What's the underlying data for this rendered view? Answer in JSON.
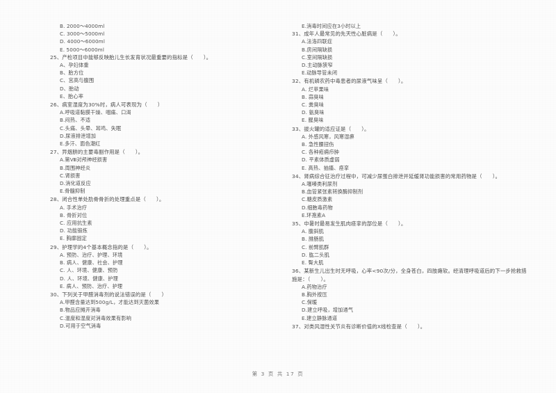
{
  "document": {
    "footer": "第 3 页 共 17 页",
    "page_number": "3",
    "total_pages": "17",
    "ink_color": "#4d4d4d",
    "paper_color": "#fcfcfc"
  },
  "left_column": {
    "orphan_options": [
      "B. 2000～4000ml",
      "C. 3000～5000ml",
      "D. 4000～6000ml",
      "E. 5000～6000ml"
    ],
    "questions": [
      {
        "number": "25",
        "stem": "25、产检项目中能够反映胎儿生长发育状况最重要的指标是（　　）。",
        "options": [
          "A、孕妇体重",
          "B、胎方位",
          "C、宫高与腹围",
          "D、胎动",
          "E、胎心率"
        ]
      },
      {
        "number": "26",
        "stem": "26、病室湿度为30%时，病人可表现为（　　）",
        "options": [
          "A.呼吸道黏膜干燥、咽痛、口渴",
          "B.闷热、不适",
          "C.头痛、头晕、耳鸣、失眠",
          "D.尿液排泄增加",
          "E.多汗、面色潮红"
        ]
      },
      {
        "number": "27",
        "stem": "27、异烟肼的主要毒副作用是（　　）。",
        "options": [
          "A.第Ⅷ对颅神经损害",
          "B.周围神经炎",
          "C.肾损害",
          "D.消化道反应",
          "E.骨髓抑制"
        ]
      },
      {
        "number": "28",
        "stem": "28、闭合性单处肋骨骨折的处理重点是（　　）。",
        "options": [
          "A. 手术治疗",
          "B. 骨折对位",
          "C. 应用抗生素",
          "D. 功能锻炼",
          "E. 胸廓固定"
        ]
      },
      {
        "number": "29",
        "stem": "29、护理学的4个基本概念指的是（　　）。",
        "options": [
          "A. 预防、治疗、护理、环境",
          "B. 病人、健康、社会、护理",
          "C. 人、环境、健康、预防",
          "D. 人、环境、健康、护理",
          "E. 病人、预防、治疗、护理"
        ]
      },
      {
        "number": "30",
        "stem": "30、下列关于甲醛消毒剂的说法错误的是（　　）",
        "options": [
          "A.甲醛含量达到500g/L，才能达到灭菌效果",
          "B.物品应摊开消毒",
          "C.温度和湿度对消毒效果有影响",
          "D.可用于空气消毒"
        ]
      }
    ]
  },
  "right_column": {
    "orphan_options": [
      "E.消毒时间应在3小时以上"
    ],
    "questions": [
      {
        "number": "31",
        "stem": "31、成年人最常见的先天性心脏病是（　　）。",
        "options": [
          "A.法洛四联症",
          "B.房间隔缺损",
          "C.室间隔缺损",
          "D.主动脉狭窄",
          "E.动脉导管未闭"
        ]
      },
      {
        "number": "32",
        "stem": "32、有机磷农药中毒患者的尿液气味呈（　　）。",
        "options": [
          "A. 烂苹果味",
          "B. 蒜臭味",
          "C. 粪臭味",
          "D. 氨臭味",
          "E. 腥臭味"
        ]
      },
      {
        "number": "33",
        "stem": "33、拔火罐的适应证是（　　）。",
        "options": [
          "A. 外感风寒，风寒湿痹",
          "B. 急性腰扭伤",
          "C. 各种疮痈疖肿",
          "D. 平素体质虚弱",
          "E. 高热、抽搐、痉挛"
        ]
      },
      {
        "number": "34",
        "stem": "34、肾病综合征治疗过程中，可减少尿蛋白排泄并延缓肾功能损害的常用药物是（　　）。",
        "options": [
          "A.噻嗪类利尿剂",
          "B.血管紧张素转换酶抑制剂",
          "C.糖皮质激素",
          "D.细胞毒药物",
          "E.环孢素A"
        ]
      },
      {
        "number": "35",
        "stem": "35、中暑时最易发生肌肉痉挛的部位是（　　）。",
        "options": [
          "A. 腹斜肌",
          "B. 腓肠肌",
          "C. 前臂肌群",
          "D. 肱二头肌",
          "E. 臀大肌"
        ]
      },
      {
        "number": "36",
        "stem": "36、某新生儿出生时无呼吸，心率<90次/分，全身苍白，四肢瘫软。经清理呼吸道后的下一步抢救措施是：（　　）。",
        "options": [
          "A.药物治疗",
          "B.胸外按压",
          "C.保暖",
          "D.建立呼吸，增加通气",
          "E.建立静脉通道"
        ]
      },
      {
        "number": "37",
        "stem": "37、对类风湿性关节炎有诊断价值的X线检查是（　　）。",
        "options": []
      }
    ]
  }
}
